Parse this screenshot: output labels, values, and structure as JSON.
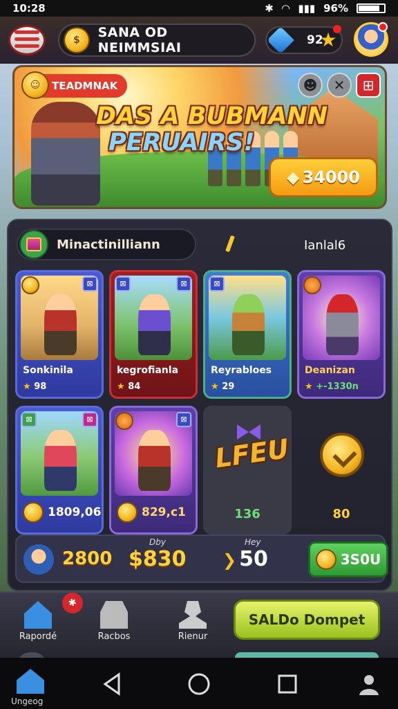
{
  "status": {
    "time": "10:28",
    "battery": "96%"
  },
  "header": {
    "player_name": "SANA OD NEIMMSIAI",
    "gems": "92"
  },
  "banner": {
    "tag": "TEADMNAK",
    "title_line1": "DAS A BUBMANN",
    "title_line2": "PERUAIRS!",
    "price": "34000",
    "icons": [
      "person-icon",
      "close-icon",
      "gift-icon"
    ]
  },
  "shop": {
    "section_title": "Minactinilliann",
    "section_right": "Ianlal6",
    "cards": [
      {
        "title": "Sonkinila",
        "rating": "98"
      },
      {
        "title": "kegrofianla",
        "rating": "84"
      },
      {
        "title": "Reyrabloes",
        "rating": "29"
      },
      {
        "title": "Deanizan",
        "rating": "+-1330n"
      },
      {
        "price": "1809,06"
      },
      {
        "price": "829,c1"
      },
      {
        "logo": "LFEU",
        "price": "136"
      },
      {
        "price": "80"
      }
    ],
    "summary": {
      "value1": "2800",
      "label2": "Dby",
      "value2": "$830",
      "label3": "Hey",
      "value3": "50",
      "buy_label": "3S0U"
    }
  },
  "nav": {
    "items": [
      {
        "label": "Rapordé"
      },
      {
        "label": "Racbos"
      },
      {
        "label": "Rienur"
      }
    ],
    "wallet_button": "SALDo Dompet"
  },
  "system": {
    "home_label": "Ungeog"
  },
  "colors": {
    "accent_gold": "#ffd23a",
    "brand_red": "#d3272b",
    "buy_green": "#2f9a33"
  }
}
